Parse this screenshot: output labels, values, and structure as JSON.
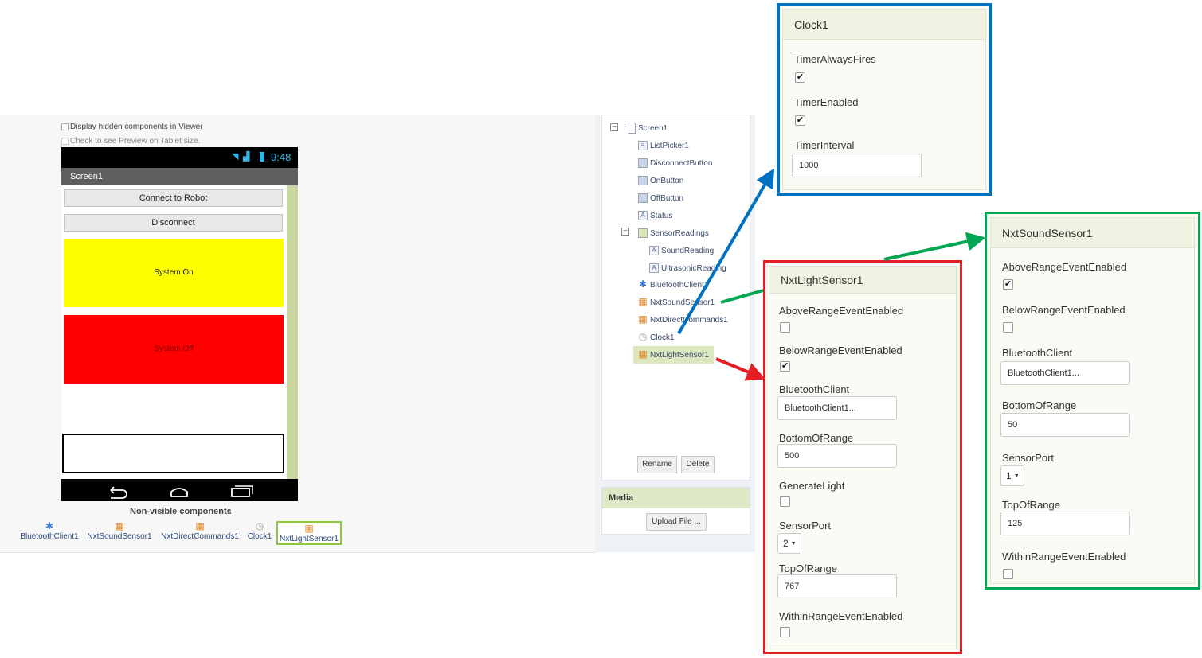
{
  "viewer": {
    "display_hidden": "Display hidden components in Viewer",
    "tablet_preview": "Check to see Preview on Tablet size.",
    "time": "9:48",
    "screen_title": "Screen1",
    "buttons": {
      "connect": "Connect to Robot",
      "disconnect": "Disconnect",
      "system_on": "System On",
      "system_off": "System Off"
    },
    "nonvisible_title": "Non-visible components",
    "nonvisible": [
      "BluetoothClient1",
      "NxtSoundSensor1",
      "NxtDirectCommands1",
      "Clock1",
      "NxtLightSensor1"
    ]
  },
  "tree": {
    "items": [
      "Screen1",
      "ListPicker1",
      "DisconnectButton",
      "OnButton",
      "OffButton",
      "Status",
      "SensorReadings",
      "SoundReading",
      "UltrasonicReading",
      "BluetoothClient1",
      "NxtSoundSensor1",
      "NxtDirectCommands1",
      "Clock1",
      "NxtLightSensor1"
    ],
    "rename": "Rename",
    "delete": "Delete"
  },
  "media": {
    "title": "Media",
    "upload": "Upload File ..."
  },
  "clock": {
    "title": "Clock1",
    "timer_always_fires": "TimerAlwaysFires",
    "timer_enabled": "TimerEnabled",
    "timer_interval": "TimerInterval",
    "timer_interval_value": "1000"
  },
  "light": {
    "title": "NxtLightSensor1",
    "above": "AboveRangeEventEnabled",
    "below": "BelowRangeEventEnabled",
    "bt": "BluetoothClient",
    "bt_value": "BluetoothClient1...",
    "bottom": "BottomOfRange",
    "bottom_value": "500",
    "generate": "GenerateLight",
    "port": "SensorPort",
    "port_value": "2",
    "top": "TopOfRange",
    "top_value": "767",
    "within": "WithinRangeEventEnabled"
  },
  "sound": {
    "title": "NxtSoundSensor1",
    "above": "AboveRangeEventEnabled",
    "below": "BelowRangeEventEnabled",
    "bt": "BluetoothClient",
    "bt_value": "BluetoothClient1...",
    "bottom": "BottomOfRange",
    "bottom_value": "50",
    "port": "SensorPort",
    "port_value": "1",
    "top": "TopOfRange",
    "top_value": "125",
    "within": "WithinRangeEventEnabled"
  },
  "colors": {
    "blue": "#0070c0",
    "red": "#e31e24",
    "green": "#00a651",
    "yellow": "#ffff00",
    "btn_red": "#ff0000"
  },
  "checks": {
    "checked": "✔"
  }
}
